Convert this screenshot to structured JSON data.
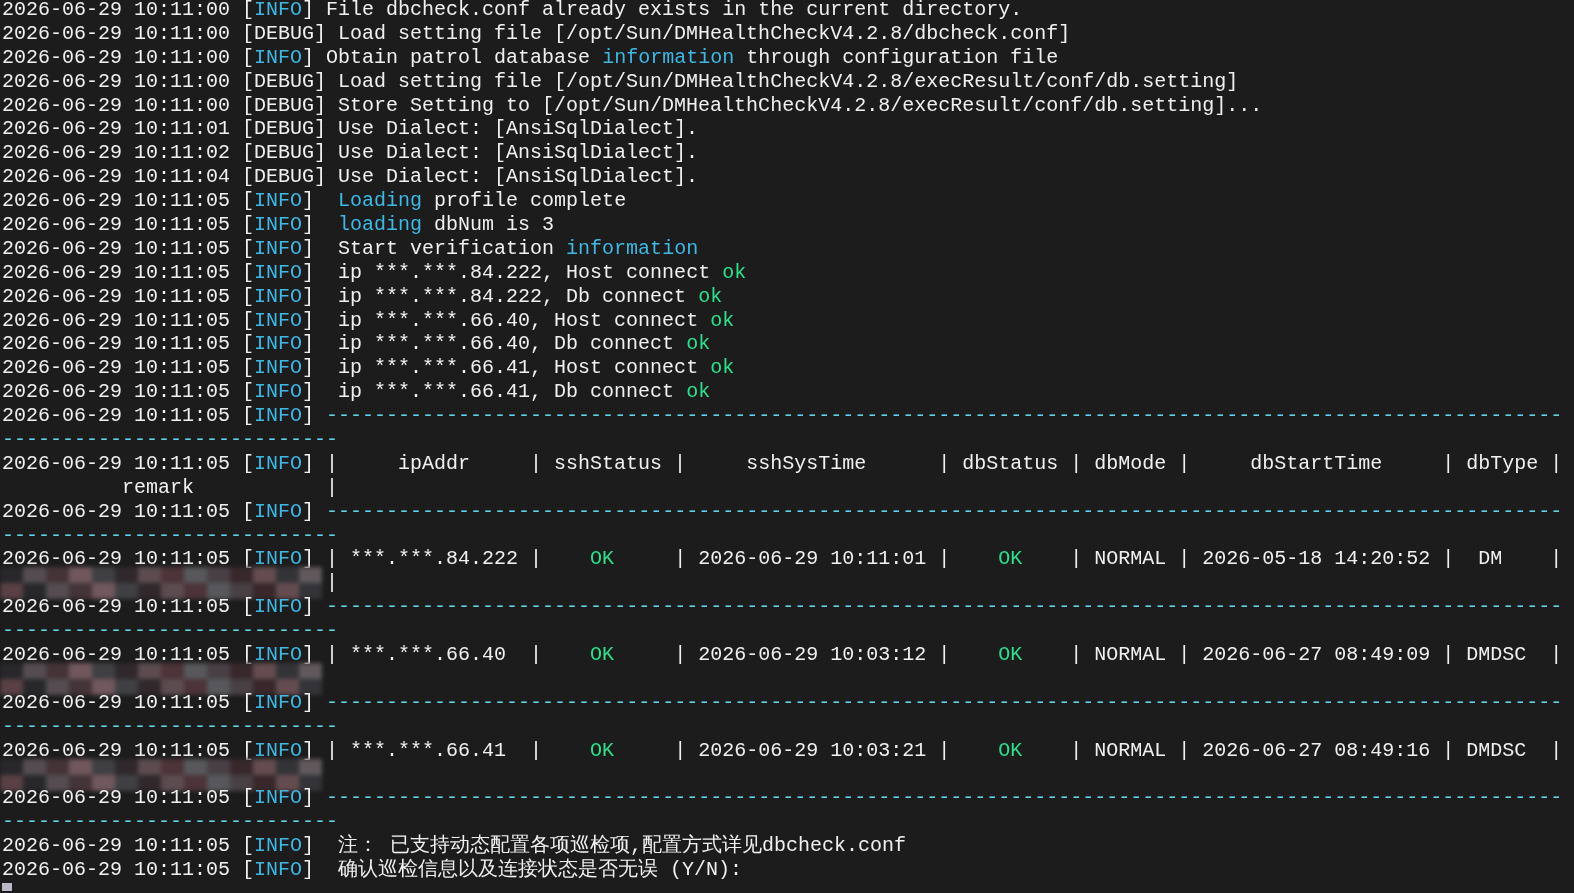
{
  "lines": [
    {
      "kind": "log",
      "segments": [
        {
          "kind": "text",
          "text": "2026-06-29 10:11:00 ["
        },
        {
          "kind": "info",
          "text": "INFO"
        },
        {
          "kind": "text",
          "text": "] File dbcheck.conf already exists in the current directory."
        }
      ]
    },
    {
      "kind": "log",
      "segments": [
        {
          "kind": "text",
          "text": "2026-06-29 10:11:00 [DEBUG] Load setting file [/opt/Sun/DMHealthCheckV4.2.8/dbcheck.conf]"
        }
      ]
    },
    {
      "kind": "log",
      "segments": [
        {
          "kind": "text",
          "text": "2026-06-29 10:11:00 ["
        },
        {
          "kind": "info",
          "text": "INFO"
        },
        {
          "kind": "text",
          "text": "] Obtain patrol database "
        },
        {
          "kind": "accent",
          "text": "information"
        },
        {
          "kind": "text",
          "text": " through configuration file"
        }
      ]
    },
    {
      "kind": "log",
      "segments": [
        {
          "kind": "text",
          "text": "2026-06-29 10:11:00 [DEBUG] Load setting file [/opt/Sun/DMHealthCheckV4.2.8/execResult/conf/db.setting]"
        }
      ]
    },
    {
      "kind": "log",
      "segments": [
        {
          "kind": "text",
          "text": "2026-06-29 10:11:00 [DEBUG] Store Setting to [/opt/Sun/DMHealthCheckV4.2.8/execResult/conf/db.setting]..."
        }
      ]
    },
    {
      "kind": "log",
      "segments": [
        {
          "kind": "text",
          "text": "2026-06-29 10:11:01 [DEBUG] Use Dialect: [AnsiSqlDialect]."
        }
      ]
    },
    {
      "kind": "log",
      "segments": [
        {
          "kind": "text",
          "text": "2026-06-29 10:11:02 [DEBUG] Use Dialect: [AnsiSqlDialect]."
        }
      ]
    },
    {
      "kind": "log",
      "segments": [
        {
          "kind": "text",
          "text": "2026-06-29 10:11:04 [DEBUG] Use Dialect: [AnsiSqlDialect]."
        }
      ]
    },
    {
      "kind": "log",
      "segments": [
        {
          "kind": "text",
          "text": "2026-06-29 10:11:05 ["
        },
        {
          "kind": "info",
          "text": "INFO"
        },
        {
          "kind": "text",
          "text": "]  "
        },
        {
          "kind": "accent",
          "text": "Loading"
        },
        {
          "kind": "text",
          "text": " profile complete"
        }
      ]
    },
    {
      "kind": "log",
      "segments": [
        {
          "kind": "text",
          "text": "2026-06-29 10:11:05 ["
        },
        {
          "kind": "info",
          "text": "INFO"
        },
        {
          "kind": "text",
          "text": "]  "
        },
        {
          "kind": "accent",
          "text": "loading"
        },
        {
          "kind": "text",
          "text": " dbNum is 3"
        }
      ]
    },
    {
      "kind": "log",
      "segments": [
        {
          "kind": "text",
          "text": "2026-06-29 10:11:05 ["
        },
        {
          "kind": "info",
          "text": "INFO"
        },
        {
          "kind": "text",
          "text": "]  Start verification "
        },
        {
          "kind": "accent",
          "text": "information"
        }
      ]
    },
    {
      "kind": "log",
      "segments": [
        {
          "kind": "text",
          "text": "2026-06-29 10:11:05 ["
        },
        {
          "kind": "info",
          "text": "INFO"
        },
        {
          "kind": "text",
          "text": "]  ip ***.***.84.222, Host connect "
        },
        {
          "kind": "ok",
          "text": "ok"
        }
      ]
    },
    {
      "kind": "log",
      "segments": [
        {
          "kind": "text",
          "text": "2026-06-29 10:11:05 ["
        },
        {
          "kind": "info",
          "text": "INFO"
        },
        {
          "kind": "text",
          "text": "]  ip ***.***.84.222, Db connect "
        },
        {
          "kind": "ok",
          "text": "ok"
        }
      ]
    },
    {
      "kind": "log",
      "segments": [
        {
          "kind": "text",
          "text": "2026-06-29 10:11:05 ["
        },
        {
          "kind": "info",
          "text": "INFO"
        },
        {
          "kind": "text",
          "text": "]  ip ***.***.66.40, Host connect "
        },
        {
          "kind": "ok",
          "text": "ok"
        }
      ]
    },
    {
      "kind": "log",
      "segments": [
        {
          "kind": "text",
          "text": "2026-06-29 10:11:05 ["
        },
        {
          "kind": "info",
          "text": "INFO"
        },
        {
          "kind": "text",
          "text": "]  ip ***.***.66.40, Db connect "
        },
        {
          "kind": "ok",
          "text": "ok"
        }
      ]
    },
    {
      "kind": "log",
      "segments": [
        {
          "kind": "text",
          "text": "2026-06-29 10:11:05 ["
        },
        {
          "kind": "info",
          "text": "INFO"
        },
        {
          "kind": "text",
          "text": "]  ip ***.***.66.41, Host connect "
        },
        {
          "kind": "ok",
          "text": "ok"
        }
      ]
    },
    {
      "kind": "log",
      "segments": [
        {
          "kind": "text",
          "text": "2026-06-29 10:11:05 ["
        },
        {
          "kind": "info",
          "text": "INFO"
        },
        {
          "kind": "text",
          "text": "]  ip ***.***.66.41, Db connect "
        },
        {
          "kind": "ok",
          "text": "ok"
        }
      ]
    },
    {
      "kind": "log",
      "segments": [
        {
          "kind": "text",
          "text": "2026-06-29 10:11:05 ["
        },
        {
          "kind": "info",
          "text": "INFO"
        },
        {
          "kind": "text",
          "text": "] "
        },
        {
          "kind": "rule",
          "text": "-------------------------------------------------------------------------------------------------------"
        }
      ]
    },
    {
      "kind": "wrap",
      "segments": [
        {
          "kind": "rule",
          "text": "----------------------------"
        }
      ]
    },
    {
      "kind": "log",
      "segments": [
        {
          "kind": "text",
          "text": "2026-06-29 10:11:05 ["
        },
        {
          "kind": "info",
          "text": "INFO"
        },
        {
          "kind": "text",
          "text": "] |     ipAddr     | sshStatus |     sshSysTime      | dbStatus | dbMode |     dbStartTime     | dbType |"
        }
      ]
    },
    {
      "kind": "wrap",
      "segments": [
        {
          "kind": "text",
          "text": "          remark           |"
        }
      ]
    },
    {
      "kind": "log",
      "segments": [
        {
          "kind": "text",
          "text": "2026-06-29 10:11:05 ["
        },
        {
          "kind": "info",
          "text": "INFO"
        },
        {
          "kind": "text",
          "text": "] "
        },
        {
          "kind": "rule",
          "text": "-------------------------------------------------------------------------------------------------------"
        }
      ]
    },
    {
      "kind": "wrap",
      "segments": [
        {
          "kind": "rule",
          "text": "----------------------------"
        }
      ]
    },
    {
      "kind": "log",
      "segments": [
        {
          "kind": "text",
          "text": "2026-06-29 10:11:05 ["
        },
        {
          "kind": "info",
          "text": "INFO"
        },
        {
          "kind": "text",
          "text": "] | ***.***.84.222 |    "
        },
        {
          "kind": "ok",
          "text": "OK"
        },
        {
          "kind": "text",
          "text": "     | 2026-06-29 10:11:01 |    "
        },
        {
          "kind": "ok",
          "text": "OK"
        },
        {
          "kind": "text",
          "text": "    | NORMAL | 2026-05-18 14:20:52 |  DM    |"
        }
      ]
    },
    {
      "kind": "wrap",
      "redacted": true,
      "segments": [
        {
          "kind": "text",
          "text": "|"
        }
      ]
    },
    {
      "kind": "log",
      "segments": [
        {
          "kind": "text",
          "text": "2026-06-29 10:11:05 ["
        },
        {
          "kind": "info",
          "text": "INFO"
        },
        {
          "kind": "text",
          "text": "] "
        },
        {
          "kind": "rule",
          "text": "-------------------------------------------------------------------------------------------------------"
        }
      ]
    },
    {
      "kind": "wrap",
      "segments": [
        {
          "kind": "rule",
          "text": "----------------------------"
        }
      ]
    },
    {
      "kind": "log",
      "segments": [
        {
          "kind": "text",
          "text": "2026-06-29 10:11:05 ["
        },
        {
          "kind": "info",
          "text": "INFO"
        },
        {
          "kind": "text",
          "text": "] | ***.***.66.40  |    "
        },
        {
          "kind": "ok",
          "text": "OK"
        },
        {
          "kind": "text",
          "text": "     | 2026-06-29 10:03:12 |    "
        },
        {
          "kind": "ok",
          "text": "OK"
        },
        {
          "kind": "text",
          "text": "    | NORMAL | 2026-06-27 08:49:09 | DMDSC  |"
        }
      ]
    },
    {
      "kind": "wrap",
      "redacted": true
    },
    {
      "kind": "log",
      "segments": [
        {
          "kind": "text",
          "text": "2026-06-29 10:11:05 ["
        },
        {
          "kind": "info",
          "text": "INFO"
        },
        {
          "kind": "text",
          "text": "] "
        },
        {
          "kind": "rule",
          "text": "-------------------------------------------------------------------------------------------------------"
        }
      ]
    },
    {
      "kind": "wrap",
      "segments": [
        {
          "kind": "rule",
          "text": "----------------------------"
        }
      ]
    },
    {
      "kind": "log",
      "segments": [
        {
          "kind": "text",
          "text": "2026-06-29 10:11:05 ["
        },
        {
          "kind": "info",
          "text": "INFO"
        },
        {
          "kind": "text",
          "text": "] | ***.***.66.41  |    "
        },
        {
          "kind": "ok",
          "text": "OK"
        },
        {
          "kind": "text",
          "text": "     | 2026-06-29 10:03:21 |    "
        },
        {
          "kind": "ok",
          "text": "OK"
        },
        {
          "kind": "text",
          "text": "    | NORMAL | 2026-06-27 08:49:16 | DMDSC  |"
        }
      ]
    },
    {
      "kind": "wrap",
      "redacted": true
    },
    {
      "kind": "log",
      "segments": [
        {
          "kind": "text",
          "text": "2026-06-29 10:11:05 ["
        },
        {
          "kind": "info",
          "text": "INFO"
        },
        {
          "kind": "text",
          "text": "] "
        },
        {
          "kind": "rule",
          "text": "-------------------------------------------------------------------------------------------------------"
        }
      ]
    },
    {
      "kind": "wrap",
      "segments": [
        {
          "kind": "rule",
          "text": "----------------------------"
        }
      ]
    },
    {
      "kind": "log",
      "segments": [
        {
          "kind": "text",
          "text": "2026-06-29 10:11:05 ["
        },
        {
          "kind": "info",
          "text": "INFO"
        },
        {
          "kind": "text",
          "text": "]  注： 已支持动态配置各项巡检项,配置方式详见dbcheck.conf"
        }
      ]
    },
    {
      "kind": "log",
      "segments": [
        {
          "kind": "text",
          "text": "2026-06-29 10:11:05 ["
        },
        {
          "kind": "info",
          "text": "INFO"
        },
        {
          "kind": "text",
          "text": "]  确认巡检信息以及连接状态是否无误 (Y/N):"
        }
      ]
    }
  ],
  "cursor": {
    "visible": true
  }
}
